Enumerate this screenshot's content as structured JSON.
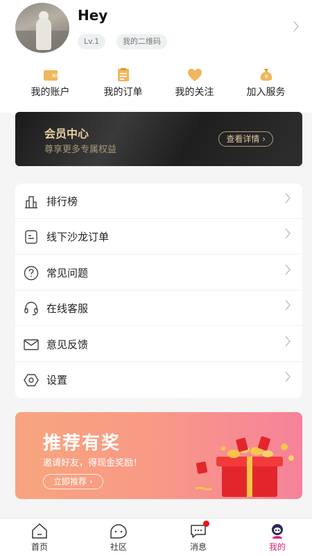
{
  "profile": {
    "name": "Hey",
    "level": "Lv.1",
    "qrcode": "我的二维码"
  },
  "quick_actions": [
    {
      "label": "我的账户",
      "icon": "wallet-icon"
    },
    {
      "label": "我的订单",
      "icon": "order-icon"
    },
    {
      "label": "我的关注",
      "icon": "heart-icon"
    },
    {
      "label": "加入服务",
      "icon": "money-bag-icon"
    }
  ],
  "vip": {
    "title": "会员中心",
    "subtitle": "尊享更多专属权益",
    "button": "查看详情"
  },
  "menu": [
    {
      "label": "排行榜",
      "icon": "ranking-icon"
    },
    {
      "label": "线下沙龙订单",
      "icon": "salon-order-icon"
    },
    {
      "label": "常见问题",
      "icon": "question-icon"
    },
    {
      "label": "在线客服",
      "icon": "headset-icon"
    },
    {
      "label": "意见反馈",
      "icon": "mail-icon"
    },
    {
      "label": "设置",
      "icon": "settings-icon"
    }
  ],
  "promo": {
    "title": "推荐有奖",
    "subtitle": "邀请好友，得现金奖励！",
    "button": "立即推荐"
  },
  "tabbar": [
    {
      "label": "首页",
      "icon": "home-icon"
    },
    {
      "label": "社区",
      "icon": "community-icon"
    },
    {
      "label": "消息",
      "icon": "message-icon"
    },
    {
      "label": "我的",
      "icon": "profile-icon"
    }
  ],
  "colors": {
    "accent": "#d6257e",
    "gold": "#e8cfa0",
    "quick_icon": "#f0b85c"
  }
}
